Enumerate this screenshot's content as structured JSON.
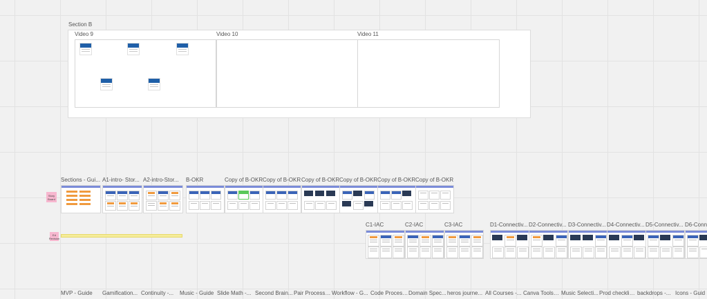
{
  "section": {
    "title": "Section B",
    "frames": [
      {
        "label": "Video 9"
      },
      {
        "label": "Video 10"
      },
      {
        "label": "Video 11"
      }
    ]
  },
  "stickies": {
    "story_board": "Story Board",
    "ed_sticky": "Ed Revision"
  },
  "row1_labels": [
    "Sections - Gui...",
    "A1-intro- Stor...",
    "A2-intro-Stor...",
    "B-OKR",
    "Copy of B-OKR",
    "Copy of B-OKR",
    "Copy of B-OKR",
    "Copy of B-OKR",
    "Copy of B-OKR",
    "Copy of B-OKR"
  ],
  "row2_labels": [
    "C1-IAC",
    "C2-IAC",
    "C3-IAC",
    "D1-Connectiv...",
    "D2-Connectiv...",
    "D3-Connectiv...",
    "D4-Connectiv...",
    "D5-Connectiv...",
    "D6-Conn"
  ],
  "bottom_labels": [
    "MVP - Guide",
    "Gamification...",
    "Continuity -...",
    "Music - Guide",
    "Slide Math -...",
    "Second Brain...",
    "Pair Process -...",
    "Workflow - G...",
    "Code Process...",
    "Domain Spec...",
    "heros journe...",
    "All Courses -...",
    "Canva Tools -...",
    "Music Selecti...",
    "Prod checklis...",
    "backdrops  -...",
    "Icons  - Guid"
  ],
  "colors": {
    "canvas": "#f1f1f1",
    "grid": "#e2e2e2",
    "thumb_header": "#1f5fa8",
    "sticky_pink": "#f7b7cf",
    "yellow_bar": "#f5ec9a",
    "orange_note": "#f09a3e"
  }
}
